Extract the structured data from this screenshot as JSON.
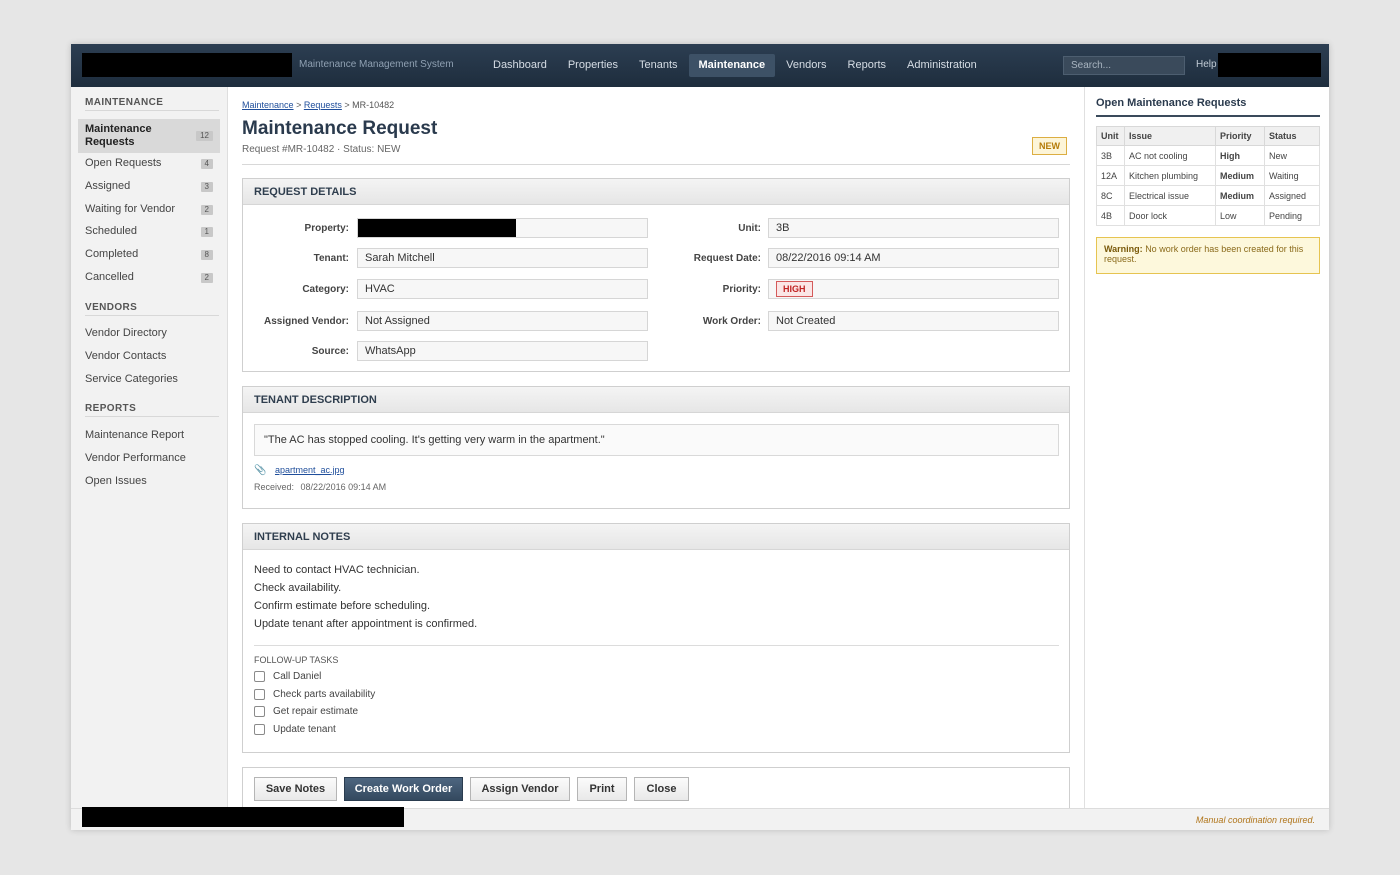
{
  "topbar": {
    "system_name": "Maintenance Management System",
    "nav": [
      "Dashboard",
      "Properties",
      "Tenants",
      "Maintenance",
      "Vendors",
      "Reports",
      "Administration"
    ],
    "active_nav": "Maintenance",
    "search_placeholder": "Search...",
    "help_label": "Help"
  },
  "sidebar": {
    "maintenance_heading": "MAINTENANCE",
    "maintenance_items": [
      {
        "label": "Maintenance Requests",
        "count": "12",
        "active": true
      },
      {
        "label": "Open Requests",
        "count": "4"
      },
      {
        "label": "Assigned",
        "count": "3"
      },
      {
        "label": "Waiting for Vendor",
        "count": "2"
      },
      {
        "label": "Scheduled",
        "count": "1"
      },
      {
        "label": "Completed",
        "count": "8"
      },
      {
        "label": "Cancelled",
        "count": "2"
      }
    ],
    "vendors_heading": "VENDORS",
    "vendor_items": [
      "Vendor Directory",
      "Vendor Contacts",
      "Service Categories"
    ],
    "reports_heading": "REPORTS",
    "report_items": [
      "Maintenance Report",
      "Vendor Performance",
      "Open Issues"
    ]
  },
  "breadcrumb": {
    "level1": "Maintenance",
    "sep": ">",
    "level2": "Requests",
    "current": "MR-10482"
  },
  "page": {
    "title": "Maintenance Request",
    "subtitle": "Request #MR-10482 · Status: NEW",
    "status_badge": "NEW"
  },
  "details": {
    "heading": "REQUEST DETAILS",
    "property_label": "Property:",
    "tenant_label": "Tenant:",
    "tenant_value": "Sarah Mitchell",
    "category_label": "Category:",
    "category_value": "HVAC",
    "assigned_vendor_label": "Assigned Vendor:",
    "assigned_vendor_value": "Not Assigned",
    "source_label": "Source:",
    "source_value": "WhatsApp",
    "unit_label": "Unit:",
    "unit_value": "3B",
    "request_date_label": "Request Date:",
    "request_date_value": "08/22/2016 09:14 AM",
    "priority_label": "Priority:",
    "priority_value": "HIGH",
    "work_order_label": "Work Order:",
    "work_order_value": "Not Created"
  },
  "tenant_description": {
    "heading": "TENANT DESCRIPTION",
    "text": "\"The AC has stopped cooling. It's getting very warm in the apartment.\"",
    "attachment": "apartment_ac.jpg",
    "received_label": "Received:",
    "received_value": "08/22/2016 09:14 AM"
  },
  "internal_notes": {
    "heading": "INTERNAL NOTES",
    "lines": [
      "Need to contact HVAC technician.",
      "Check availability.",
      "Confirm estimate before scheduling.",
      "Update tenant after appointment is confirmed."
    ],
    "followup_heading": "FOLLOW-UP TASKS",
    "tasks": [
      "Call Daniel",
      "Check parts availability",
      "Get repair estimate",
      "Update tenant"
    ]
  },
  "buttons": {
    "save_notes": "Save Notes",
    "create_work_order": "Create Work Order",
    "assign_vendor": "Assign Vendor",
    "print": "Print",
    "close": "Close"
  },
  "open_requests": {
    "title": "Open Maintenance Requests",
    "columns": [
      "Unit",
      "Issue",
      "Priority",
      "Status"
    ],
    "rows": [
      [
        "3B",
        "AC not cooling",
        "High",
        "New"
      ],
      [
        "12A",
        "Kitchen plumbing",
        "Medium",
        "Waiting"
      ],
      [
        "8C",
        "Electrical issue",
        "Medium",
        "Assigned"
      ],
      [
        "4B",
        "Door lock",
        "Low",
        "Pending"
      ]
    ],
    "warning_label": "Warning:",
    "warning_text": "No work order has been created for this request."
  },
  "footer": {
    "note": "Manual coordination required."
  },
  "colors": {
    "topbar": "#1e2d3d",
    "primary_button": "#34495f",
    "priority_high": "#c02424",
    "badge_new": "#b57b08"
  }
}
